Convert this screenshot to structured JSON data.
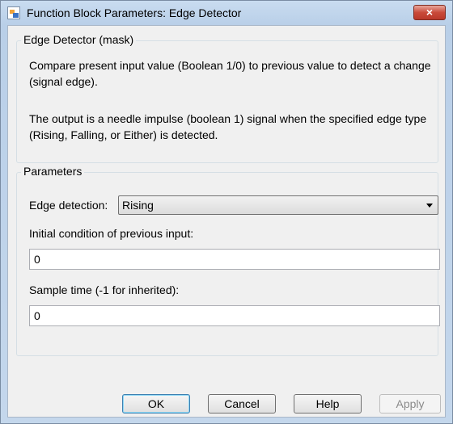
{
  "window": {
    "title": "Function Block Parameters: Edge Detector",
    "close_label": "×"
  },
  "mask_group": {
    "legend": "Edge Detector (mask)",
    "description1": "Compare present input value (Boolean 1/0) to previous value to detect a change (signal edge).",
    "description2": "The output is a needle impulse (boolean 1) signal when  the specified edge type (Rising, Falling, or Either) is detected."
  },
  "parameters": {
    "legend": "Parameters",
    "edge_detection": {
      "label": "Edge detection:",
      "value": "Rising"
    },
    "initial_condition": {
      "label": "Initial condition of previous input:",
      "value": "0"
    },
    "sample_time": {
      "label": "Sample time (-1 for inherited):",
      "value": "0"
    }
  },
  "buttons": {
    "ok": "OK",
    "cancel": "Cancel",
    "help": "Help",
    "apply": "Apply"
  }
}
